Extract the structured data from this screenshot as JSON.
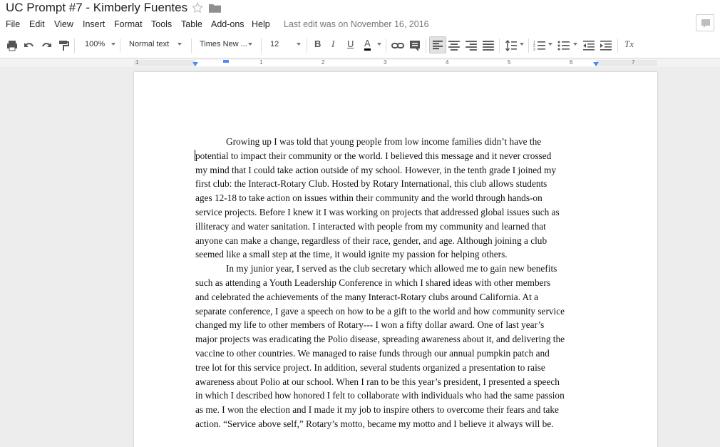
{
  "doc": {
    "title": "UC Prompt #7 - Kimberly Fuentes",
    "last_edit": "Last edit was on November 16, 2016"
  },
  "menu": [
    "File",
    "Edit",
    "View",
    "Insert",
    "Format",
    "Tools",
    "Table",
    "Add-ons",
    "Help"
  ],
  "toolbar": {
    "zoom": "100%",
    "style": "Normal text",
    "font": "Times New ...",
    "size": "12",
    "bold": "B",
    "italic": "I",
    "underline": "U",
    "text_color": "A",
    "clear_formatting": "Tx"
  },
  "ruler": [
    "1",
    "1",
    "2",
    "3",
    "4",
    "5",
    "6",
    "7"
  ],
  "body": {
    "lines": [
      "Growing up I was told that young people from low income families didn’t have the",
      "potential to impact their community or the world. I believed this message and it never crossed",
      "my mind that I could take action outside of my school. However, in the tenth grade I joined my",
      "first club: the Interact-Rotary Club. Hosted by Rotary International, this club allows students",
      "ages 12-18 to take action on issues within their community and the world through hands-on",
      "service projects. Before I knew it I was working on projects that addressed global issues such as",
      "illiteracy and water sanitation. I interacted with people from my community and learned that",
      "anyone can make a change, regardless of their race, gender, and age. Although joining a club",
      "seemed like a small step at the time, it would ignite my passion for helping others.",
      "In my junior year, I served as the club secretary which allowed me to gain new benefits",
      "such as attending a Youth Leadership Conference in which I shared ideas with other members",
      "and celebrated the achievements of the many Interact-Rotary clubs around California. At a",
      "separate conference, I gave a speech on how to be a gift to the world and how community service",
      "changed my life to other members of Rotary--- I won a fifty dollar award. One of last year’s",
      "major projects was eradicating the Polio disease, spreading awareness about it, and delivering the",
      "vaccine to other countries. We managed to raise funds through our annual pumpkin patch and",
      "tree lot for this service project. In addition, several students organized a presentation to raise",
      "awareness about Polio at our school. When I ran to be this year’s president, I presented a speech",
      "in which I described how honored I felt to collaborate with individuals who had the same passion",
      "as me. I won the election and I made it my job to inspire others to overcome their fears and take",
      "action. “Service above self,” Rotary’s motto, became my motto and I believe it always will be."
    ]
  }
}
